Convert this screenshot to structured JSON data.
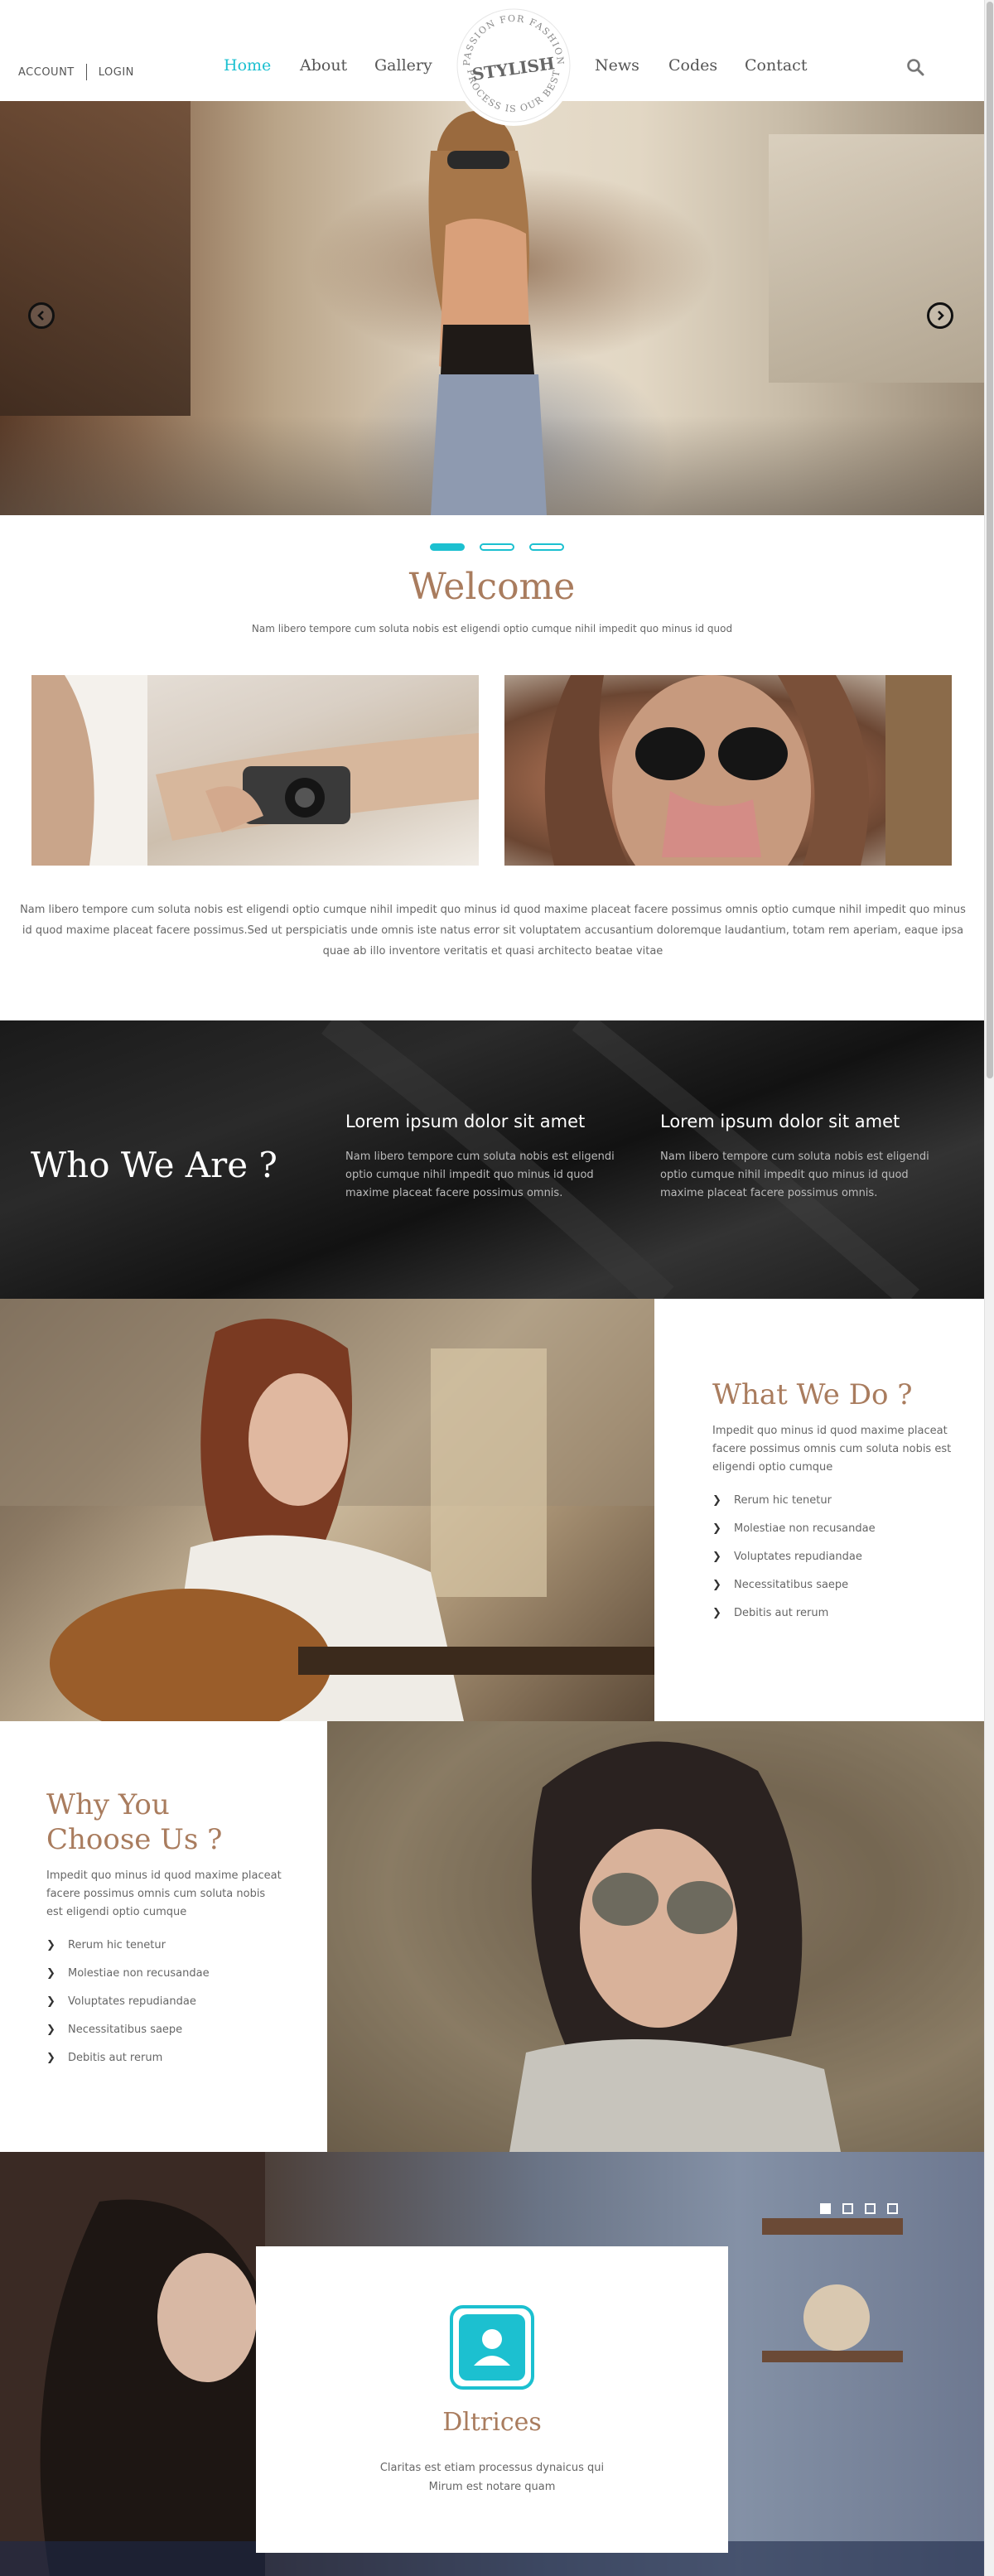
{
  "header": {
    "account_label": "ACCOUNT",
    "login_label": "LOGIN",
    "nav": [
      {
        "label": "Home",
        "active": true
      },
      {
        "label": "About"
      },
      {
        "label": "Gallery"
      },
      {
        "label": "News"
      },
      {
        "label": "Codes"
      },
      {
        "label": "Contact"
      }
    ],
    "logo": {
      "brand": "STYLISH",
      "top_arc": "PASSION FOR FASHION",
      "bottom_arc": "PROCESS IS OUR BEST"
    },
    "search_icon": "search-icon"
  },
  "hero": {
    "prev_icon": "chevron-left-icon",
    "next_icon": "chevron-right-icon",
    "slide_count": 3,
    "active_slide": 1
  },
  "welcome": {
    "title": "Welcome",
    "subtitle": "Nam libero tempore cum soluta nobis est eligendi optio cumque nihil impedit quo minus id quod",
    "body": "Nam libero tempore cum soluta nobis est eligendi optio cumque nihil impedit quo minus id quod maxime placeat facere possimus omnis optio cumque nihil impedit quo minus id quod maxime placeat facere possimus.Sed ut perspiciatis unde omnis iste natus error sit voluptatem accusantium doloremque laudantium, totam rem aperiam, eaque ipsa quae ab illo inventore veritatis et quasi architecto beatae vitae"
  },
  "who": {
    "title": "Who We Are ?",
    "columns": [
      {
        "heading": "Lorem ipsum dolor sit amet",
        "text": "Nam libero tempore cum soluta nobis est eligendi optio cumque nihil impedit quo minus id quod maxime placeat facere possimus omnis."
      },
      {
        "heading": "Lorem ipsum dolor sit amet",
        "text": "Nam libero tempore cum soluta nobis est eligendi optio cumque nihil impedit quo minus id quod maxime placeat facere possimus omnis."
      }
    ]
  },
  "what": {
    "title": "What We Do ?",
    "text": "Impedit quo minus id quod maxime placeat facere possimus omnis cum soluta nobis est eligendi optio cumque",
    "items": [
      "Rerum hic tenetur",
      "Molestiae non recusandae",
      "Voluptates repudiandae",
      "Necessitatibus saepe",
      "Debitis aut rerum"
    ]
  },
  "why": {
    "title": "Why You Choose Us ?",
    "text": "Impedit quo minus id quod maxime placeat facere possimus omnis cum soluta nobis est eligendi optio cumque",
    "items": [
      "Rerum hic tenetur",
      "Molestiae non recusandae",
      "Voluptates repudiandae",
      "Necessitatibus saepe",
      "Debitis aut rerum"
    ]
  },
  "testimonial": {
    "slide_count": 4,
    "active_slide": 1,
    "avatar_icon": "user-icon",
    "name": "Dltrices",
    "text": "Claritas est etiam processus dynaicus qui Mirum est notare quam"
  },
  "colors": {
    "accent": "#1cc0d0",
    "heading": "#a97c5e",
    "text": "#666666"
  }
}
